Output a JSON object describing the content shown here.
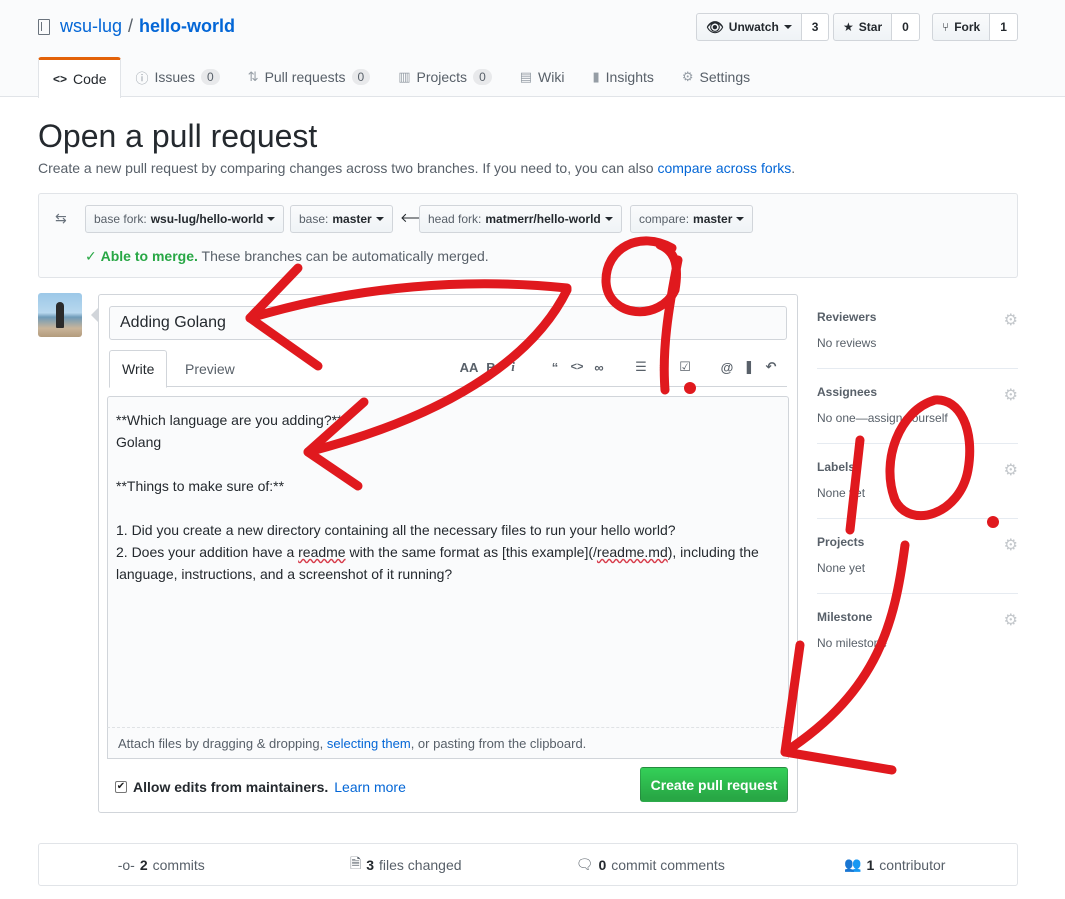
{
  "repo": {
    "owner": "wsu-lug",
    "separator": "/",
    "name": "hello-world"
  },
  "actions": {
    "watch": {
      "label": "Unwatch",
      "count": "3"
    },
    "star": {
      "label": "Star",
      "count": "0"
    },
    "fork": {
      "label": "Fork",
      "count": "1"
    }
  },
  "nav": [
    {
      "label": "Code"
    },
    {
      "label": "Issues",
      "count": "0"
    },
    {
      "label": "Pull requests",
      "count": "0"
    },
    {
      "label": "Projects",
      "count": "0"
    },
    {
      "label": "Wiki"
    },
    {
      "label": "Insights"
    },
    {
      "label": "Settings"
    }
  ],
  "page": {
    "title": "Open a pull request",
    "subtitle": "Create a new pull request by comparing changes across two branches. If you need to, you can also",
    "subtitle_link": "compare across forks",
    "subtitle_end": "."
  },
  "range": {
    "base_fork_label": "base fork:",
    "base_fork_value": "wsu-lug/hello-world",
    "base_label": "base:",
    "base_value": "master",
    "head_fork_label": "head fork:",
    "head_fork_value": "matmerr/hello-world",
    "compare_label": "compare:",
    "compare_value": "master",
    "merge_ok": "Able to merge.",
    "merge_msg": "These branches can be automatically merged."
  },
  "composer": {
    "title_value": "Adding Golang",
    "tabs": {
      "write": "Write",
      "preview": "Preview"
    },
    "body_lines": [
      "**Which language are you adding?**",
      "Golang",
      "",
      "**Things to make sure of:**",
      "",
      "1. Did you create a new directory containing all the necessary files to run your hello world?"
    ],
    "body_line7_a": "2. Does your addition have a ",
    "body_line7_sq1": "readme",
    "body_line7_b": " with the same format as [this example](/",
    "body_line7_sq2": "readme.md",
    "body_line7_c": "), including the language, instructions, and a screenshot of it running?",
    "attach_a": "Attach files by dragging & dropping,",
    "attach_link": "selecting them",
    "attach_b": ", or pasting from the clipboard.",
    "allow_label": "Allow edits from maintainers.",
    "learn_more": "Learn more",
    "submit": "Create pull request"
  },
  "sidebar": [
    {
      "heading": "Reviewers",
      "value": "No reviews"
    },
    {
      "heading": "Assignees",
      "value": "No one—assign yourself"
    },
    {
      "heading": "Labels",
      "value": "None yet"
    },
    {
      "heading": "Projects",
      "value": "None yet"
    },
    {
      "heading": "Milestone",
      "value": "No milestone"
    }
  ],
  "summary": {
    "commits_n": "2",
    "commits_l": "commits",
    "files_n": "3",
    "files_l": "files changed",
    "comments_n": "0",
    "comments_l": "commit comments",
    "contrib_n": "1",
    "contrib_l": "contributor"
  },
  "annotations": {
    "step_a": "9.",
    "step_b": "10.",
    "color": "#e0191e"
  }
}
